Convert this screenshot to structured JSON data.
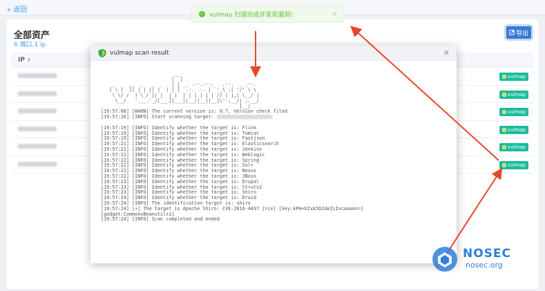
{
  "topbar": {
    "back_label": "« 返回"
  },
  "page": {
    "title": "全部资产",
    "subtitle": "6 端口,1 ip",
    "export_label": "导出"
  },
  "table": {
    "header_ip": "IP",
    "row_tag": "vulmap",
    "rows": [
      "",
      "",
      "",
      "",
      "",
      ""
    ]
  },
  "toast": {
    "message": "vulmap 扫描完成并发现漏洞！"
  },
  "dialog": {
    "title": "vulmap scan result",
    "console_lines": [
      "[19:57:08] [WARN] The current version is: 0.7, Version check filed",
      "[19:57:18] [INFO] Start scanning target:",
      "",
      "[19:57:19] [INFO] Identify whether the target is: Flink",
      "[19:57:19] [INFO] Identify whether the target is: Tomcat",
      "[19:57:19] [INFO] Identify whether the target is: Fastjson",
      "[19:57:21] [INFO] Identify whether the target is: Elasticsearch",
      "[19:57:21] [INFO] Identify whether the target is: Jenkins",
      "[19:57:21] [INFO] Identify whether the target is: Weblogic",
      "[19:57:22] [INFO] Identify whether the target is: Spring",
      "[19:57:22] [INFO] Identify whether the target is: Solr",
      "[19:57:22] [INFO] Identify whether the target is: Nexus",
      "[19:57:22] [INFO] Identify whether the target is: JBoss",
      "[19:57:23] [INFO] Identify whether the target is: Drupal",
      "[19:57:23] [INFO] Identify whether the target is: Struts2",
      "[19:57:23] [INFO] Identify whether the target is: Shiro",
      "[19:57:24] [INFO] Identify whether the target is: Druid",
      "[19:57:24] [INFO] The identification target is: shiro",
      "[19:57:24] [+] The target is Apache Shiro: CVE-2016-4437 [rce] [key:kPH+bIxk5D2deZiIxcaaaA==]",
      "[gadget:CommonsBeanutils1]",
      "[19:57:24] [INFO] Scan completed and ended"
    ]
  },
  "watermark": {
    "brand": "NOSEC",
    "domain": "nosec.org"
  },
  "colors": {
    "accent": "#409eff",
    "tag": "#1abc9c",
    "success": "#67c23a",
    "arrow": "#e8462a",
    "brand": "#2f7fd8"
  },
  "icons": [
    "shield-icon",
    "check-circle-icon",
    "close-icon",
    "export-icon",
    "sort-icon"
  ]
}
